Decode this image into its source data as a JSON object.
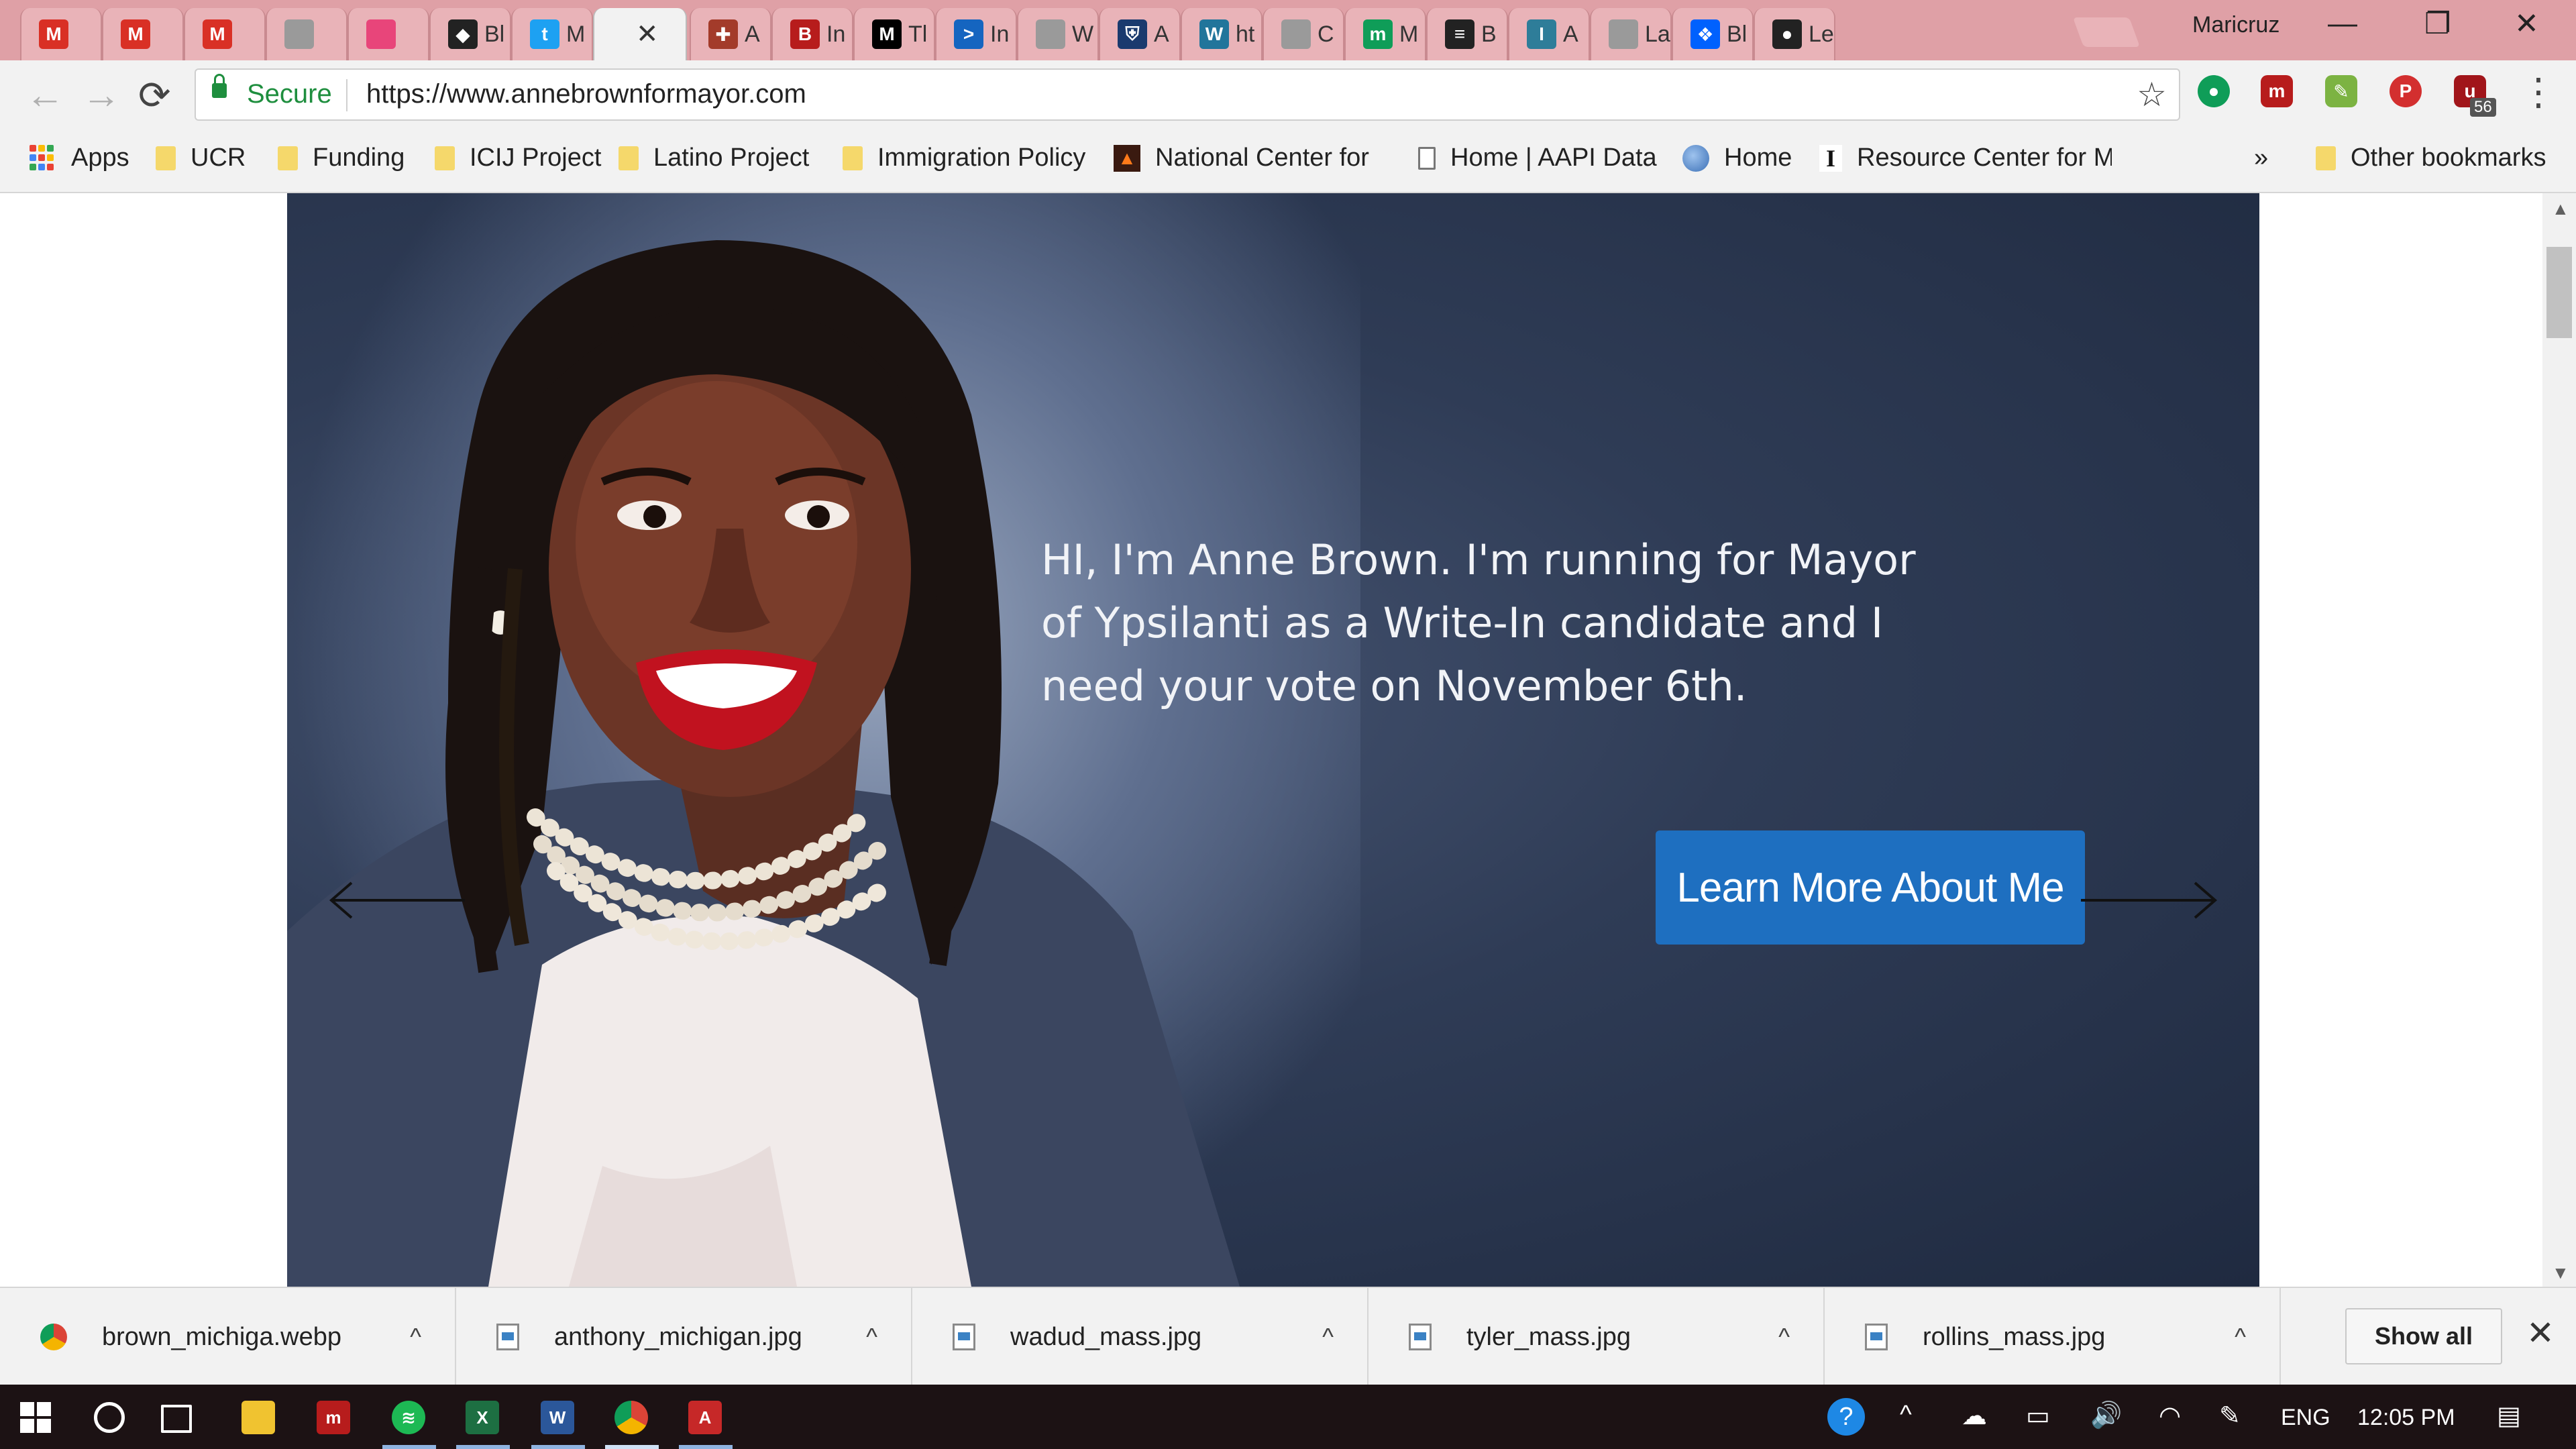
{
  "browser": {
    "profile_name": "Maricruz",
    "tabs": [
      {
        "label": "",
        "icon": "gmail-icon",
        "color": "#d93025",
        "glyph": "M"
      },
      {
        "label": "",
        "icon": "gmail-icon",
        "color": "#d93025",
        "glyph": "M"
      },
      {
        "label": "",
        "icon": "gmail-icon",
        "color": "#d93025",
        "glyph": "M"
      },
      {
        "label": "",
        "icon": "page-icon",
        "color": "#9a9a9a",
        "glyph": ""
      },
      {
        "label": "",
        "icon": "pink-square-icon",
        "color": "#e8457a",
        "glyph": ""
      },
      {
        "label": "Bl",
        "icon": "dark-logo-icon",
        "color": "#222222",
        "glyph": "◆"
      },
      {
        "label": "M",
        "icon": "twitter-icon",
        "color": "#1da1f2",
        "glyph": "t"
      },
      {
        "label": "",
        "icon": "active-tab",
        "color": "#f2f2f2",
        "glyph": ""
      },
      {
        "label": "A",
        "icon": "cross-icon",
        "color": "#a33b2a",
        "glyph": "✚"
      },
      {
        "label": "In",
        "icon": "red-logo-icon",
        "color": "#b71c1c",
        "glyph": "B"
      },
      {
        "label": "Tl",
        "icon": "medium-icon",
        "color": "#000000",
        "glyph": "M"
      },
      {
        "label": "In",
        "icon": "play-icon",
        "color": "#1565c0",
        "glyph": ">"
      },
      {
        "label": "W",
        "icon": "page-icon",
        "color": "#9a9a9a",
        "glyph": ""
      },
      {
        "label": "A",
        "icon": "shield-icon",
        "color": "#1a3a6e",
        "glyph": "⛨"
      },
      {
        "label": "ht",
        "icon": "wordpress-icon",
        "color": "#21759b",
        "glyph": "W"
      },
      {
        "label": "C",
        "icon": "page-icon",
        "color": "#9a9a9a",
        "glyph": ""
      },
      {
        "label": "M",
        "icon": "green-logo-icon",
        "color": "#0f9d58",
        "glyph": "m"
      },
      {
        "label": "B",
        "icon": "buffer-icon",
        "color": "#222222",
        "glyph": "≡"
      },
      {
        "label": "A",
        "icon": "ispp-icon",
        "color": "#2e7d99",
        "glyph": "I"
      },
      {
        "label": "La",
        "icon": "page-icon",
        "color": "#9a9a9a",
        "glyph": ""
      },
      {
        "label": "Bl",
        "icon": "dropbox-icon",
        "color": "#0061fe",
        "glyph": "❖"
      },
      {
        "label": "Le",
        "icon": "github-icon",
        "color": "#222222",
        "glyph": "●"
      }
    ],
    "nav": {
      "back": "←",
      "forward": "→",
      "reload": "⟳"
    },
    "address": {
      "secure_label": "Secure",
      "url": "https://www.annebrownformayor.com"
    },
    "bookmarks": [
      {
        "label": "Apps",
        "icon": "apps-grid-icon"
      },
      {
        "label": "UCR",
        "icon": "folder-icon"
      },
      {
        "label": "Funding",
        "icon": "folder-icon"
      },
      {
        "label": "ICIJ Project",
        "icon": "folder-icon"
      },
      {
        "label": "Latino Project",
        "icon": "folder-icon"
      },
      {
        "label": "Immigration Policy",
        "icon": "folder-icon"
      },
      {
        "label": "National Center for F",
        "icon": "flame-icon"
      },
      {
        "label": "Home | AAPI Data",
        "icon": "page-icon"
      },
      {
        "label": "Home",
        "icon": "globe-icon"
      },
      {
        "label": "Resource Center for M",
        "icon": "letter-i-icon"
      }
    ],
    "bookmarks_overflow": "»",
    "other_bookmarks": "Other bookmarks",
    "extension_badge": "56"
  },
  "hero": {
    "message": "HI, I'm Anne Brown.  I'm running for Mayor of Ypsilanti as a Write-In candidate and I need your vote on November 6th.",
    "cta_label": "Learn More About Me",
    "slide_count": 4,
    "active_slide": 1
  },
  "downloads": {
    "items": [
      {
        "name": "brown_michiga.webp"
      },
      {
        "name": "anthony_michigan.jpg"
      },
      {
        "name": "wadud_mass.jpg"
      },
      {
        "name": "tyler_mass.jpg"
      },
      {
        "name": "rollins_mass.jpg"
      }
    ],
    "show_all_label": "Show all",
    "close_glyph": "✕"
  },
  "taskbar": {
    "language": "ENG",
    "time": "12:05 PM"
  },
  "colors": {
    "tab_frame": "#dfa0a6",
    "secure_green": "#1e8e3e",
    "cta_blue": "#1e6fc0",
    "hero_navy": "#2f3c56"
  }
}
